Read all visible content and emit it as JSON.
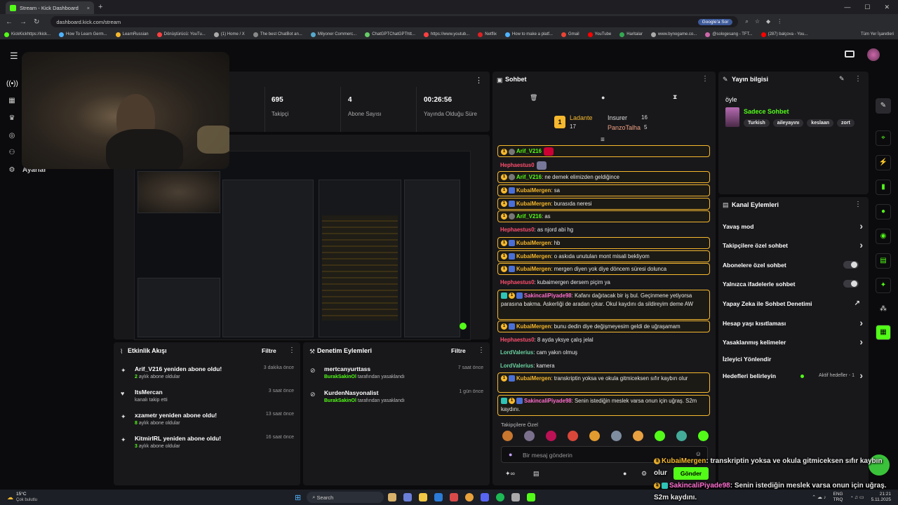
{
  "browser": {
    "tab_title": "Stream - Kick Dashboard",
    "tab_close": "×",
    "new_tab": "+",
    "url": "dashboard.kick.com/stream",
    "google_btn": "Google'a Sor",
    "bookmarks": [
      "KickKickhttps://kick...",
      "How To Learn Germ...",
      "LearnRussian",
      "Dönüştürücü: YouTu...",
      "(1) Home / X",
      "The best ChatBot an...",
      "Milyoner Commerc...",
      "ChatGPTChatGPThtt...",
      "https://www.youtub...",
      "Netflix",
      "How to make a platf...",
      "Gmail",
      "YouTube",
      "Haritalar",
      "www.bynogame.co...",
      "@sologesang - TFT...",
      "(287) balçova - You..."
    ],
    "all_bookmarks": "Tüm Yer İşaretleri"
  },
  "sidebar": {
    "settings_label": "Ayarlar"
  },
  "stats": {
    "followers_value": "695",
    "followers_label": "Takipçi",
    "subs_value": "4",
    "subs_label": "Abone Sayısı",
    "uptime_value": "00:26:56",
    "uptime_label": "Yayında Olduğu Süre"
  },
  "activity": {
    "title": "Etkinlik Akışı",
    "filter": "Filtre",
    "items": [
      {
        "title": "Arif_V216 yeniden abone oldu!",
        "num": "2",
        "sub": "aylık abone oldular",
        "time": "3 dakika önce"
      },
      {
        "title": "ItsMercan",
        "num": "",
        "sub": "kanalı takip etti",
        "time": "3 saat önce"
      },
      {
        "title": "xzametr yeniden abone oldu!",
        "num": "8",
        "sub": "aylık abone oldular",
        "time": "13 saat önce"
      },
      {
        "title": "KitmirIRL yeniden abone oldu!",
        "num": "3",
        "sub": "aylık abone oldular",
        "time": "16 saat önce"
      }
    ]
  },
  "moderation": {
    "title": "Denetim Eylemleri",
    "filter": "Filtre",
    "items": [
      {
        "title": "mertcanyurttass",
        "mod": "BurakSakinOl",
        "sub": "tarafından yasaklandı",
        "time": "7 saat önce"
      },
      {
        "title": "KurdenNasyonalist",
        "mod": "BurakSakinOl",
        "sub": "tarafından yasaklandı",
        "time": "1 gün önce"
      }
    ]
  },
  "chat": {
    "title": "Sohbet",
    "leaderboard": {
      "first": "Ladante",
      "first_val": "17",
      "second": "Insurer",
      "second_val": "16",
      "third": "PanzoTalha",
      "third_val": "5"
    },
    "messages": [
      {
        "user": "Arif_V216",
        "text": "",
        "color": "u-g",
        "hl": true
      },
      {
        "user": "Hephaestus0",
        "text": "",
        "color": "u-p",
        "hl": false
      },
      {
        "user": "Arif_V216",
        "text": ": ne demek elimizden geldiğince",
        "color": "u-g",
        "hl": true
      },
      {
        "user": "KubaiMergen",
        "text": ": sa",
        "color": "u-o",
        "hl": true
      },
      {
        "user": "KubaiMergen",
        "text": ": burasıda neresi",
        "color": "u-o",
        "hl": true
      },
      {
        "user": "Arif_V216",
        "text": ": as",
        "color": "u-g",
        "hl": true
      },
      {
        "user": "Hephaestus0",
        "text": ": as njord abi hg",
        "color": "u-p",
        "hl": false
      },
      {
        "user": "KubaiMergen",
        "text": ": hb",
        "color": "u-o",
        "hl": true
      },
      {
        "user": "KubaiMergen",
        "text": ": o askıda unutulan mont misali bekliyom",
        "color": "u-o",
        "hl": true
      },
      {
        "user": "KubaiMergen",
        "text": ": mergen diyen yok diye döncem süresi dolunca",
        "color": "u-o",
        "hl": true
      },
      {
        "user": "Hephaestus0",
        "text": ": kubaimergen dersem piçim ya",
        "color": "u-p",
        "hl": false
      },
      {
        "user": "SakincaliPiyade98",
        "text": ": Kafanı dağıtacak bir iş bul. Geçinmene yetiyorsa parasına bakma. Askerliği de aradan çıkar. Okul kaydını da sildireyim deme AW",
        "color": "u-pk",
        "hl": true
      },
      {
        "user": "KubaiMergen",
        "text": ": bunu dedin diye değişmeyesim geldi de uğraşamam",
        "color": "u-o",
        "hl": true
      },
      {
        "user": "Hephaestus0",
        "text": ": 8 ayda yksye çalış jelal",
        "color": "u-p",
        "hl": false
      },
      {
        "user": "LordValerius",
        "text": ": cam yakın olmuş",
        "color": "u-gr",
        "hl": false
      },
      {
        "user": "LordValerius",
        "text": ": kamera",
        "color": "u-gr",
        "hl": false
      },
      {
        "user": "KubaiMergen",
        "text": ": transkriptin yoksa ve okula gitmiceksen sıfır kaybın olur",
        "color": "u-o",
        "hl": true
      },
      {
        "user": "SakincaliPiyade98",
        "text": ": Senin istediğin meslek varsa onun için uğraş. S2m kaydını.",
        "color": "u-pk",
        "hl": true
      }
    ],
    "emote_section": "Takipçilere Özel",
    "input_placeholder": "Bir mesaj gönderin",
    "send": "Gönder"
  },
  "stream_info": {
    "title": "Yayın bilgisi",
    "stream_title": "öyle",
    "category": "Sadece Sohbet",
    "tags": [
      "Turkish",
      "aileyayını",
      "keslaan",
      "zort"
    ]
  },
  "channel_actions": {
    "title": "Kanal Eylemleri",
    "items": [
      {
        "label": "Yavaş mod",
        "ctl": "chev"
      },
      {
        "label": "Takipçilere özel sohbet",
        "ctl": "chev"
      },
      {
        "label": "Abonelere özel sohbet",
        "ctl": "toggle"
      },
      {
        "label": "Yalnızca ifadelerle sohbet",
        "ctl": "toggle"
      },
      {
        "label": "Yapay Zeka ile Sohbet Denetimi",
        "ctl": "ext"
      },
      {
        "label": "Hesap yaşı kısıtlaması",
        "ctl": "chev"
      },
      {
        "label": "Yasaklanmış kelimeler",
        "ctl": "chev"
      },
      {
        "label": "İzleyici Yönlendir",
        "ctl": "none"
      },
      {
        "label": "Hedefleri belirleyin",
        "ctl": "goal"
      }
    ],
    "active_goals": "Aktif hedefler - 1"
  },
  "overlay": {
    "line1_user": "KubaiMergen",
    "line1_text": ": transkriptin yoksa ve okula gitmiceksen sıfır kaybın",
    "line1_tail": "olur",
    "line2_user": "SakincaliPiyade98",
    "line2_text": ": Senin istediğin meslek varsa onun için uğraş.",
    "line3": "S2m kaydını."
  },
  "taskbar": {
    "weather_temp": "15°C",
    "weather_desc": "Çok bulutlu",
    "search": "Search",
    "lang1": "ENG",
    "lang2": "TRQ",
    "time": "21:21",
    "date": "5.11.2025"
  },
  "colors": {
    "accent": "#53fc18",
    "panel": "#18181b",
    "gold": "#f5b82e"
  }
}
